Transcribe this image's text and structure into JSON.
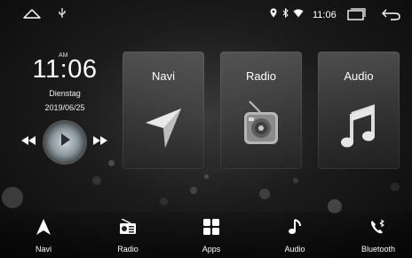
{
  "status_bar": {
    "time": "11:06",
    "icons": [
      "home-icon",
      "usb-icon",
      "location-icon",
      "bluetooth-icon",
      "wifi-icon",
      "recent-apps-icon",
      "back-icon"
    ]
  },
  "clock_widget": {
    "ampm": "AM",
    "time": "11:06",
    "weekday": "Dienstag",
    "date": "2019/06/25"
  },
  "media_player": {
    "icons": [
      "previous-icon",
      "play-icon",
      "next-icon"
    ]
  },
  "tiles": [
    {
      "label": "Navi",
      "icon": "navigation-arrow-icon"
    },
    {
      "label": "Radio",
      "icon": "radio-icon"
    },
    {
      "label": "Audio",
      "icon": "music-note-icon"
    }
  ],
  "dock": [
    {
      "label": "Navi",
      "icon": "navigation-arrow-icon"
    },
    {
      "label": "Radio",
      "icon": "radio-icon"
    },
    {
      "label": "Apps",
      "icon": "apps-grid-icon"
    },
    {
      "label": "Audio",
      "icon": "music-note-icon"
    },
    {
      "label": "Bluetooth",
      "icon": "bluetooth-phone-icon"
    }
  ],
  "colors": {
    "background": "#1c1c1c",
    "tile": "#5a5a5a",
    "text": "#ffffff"
  }
}
